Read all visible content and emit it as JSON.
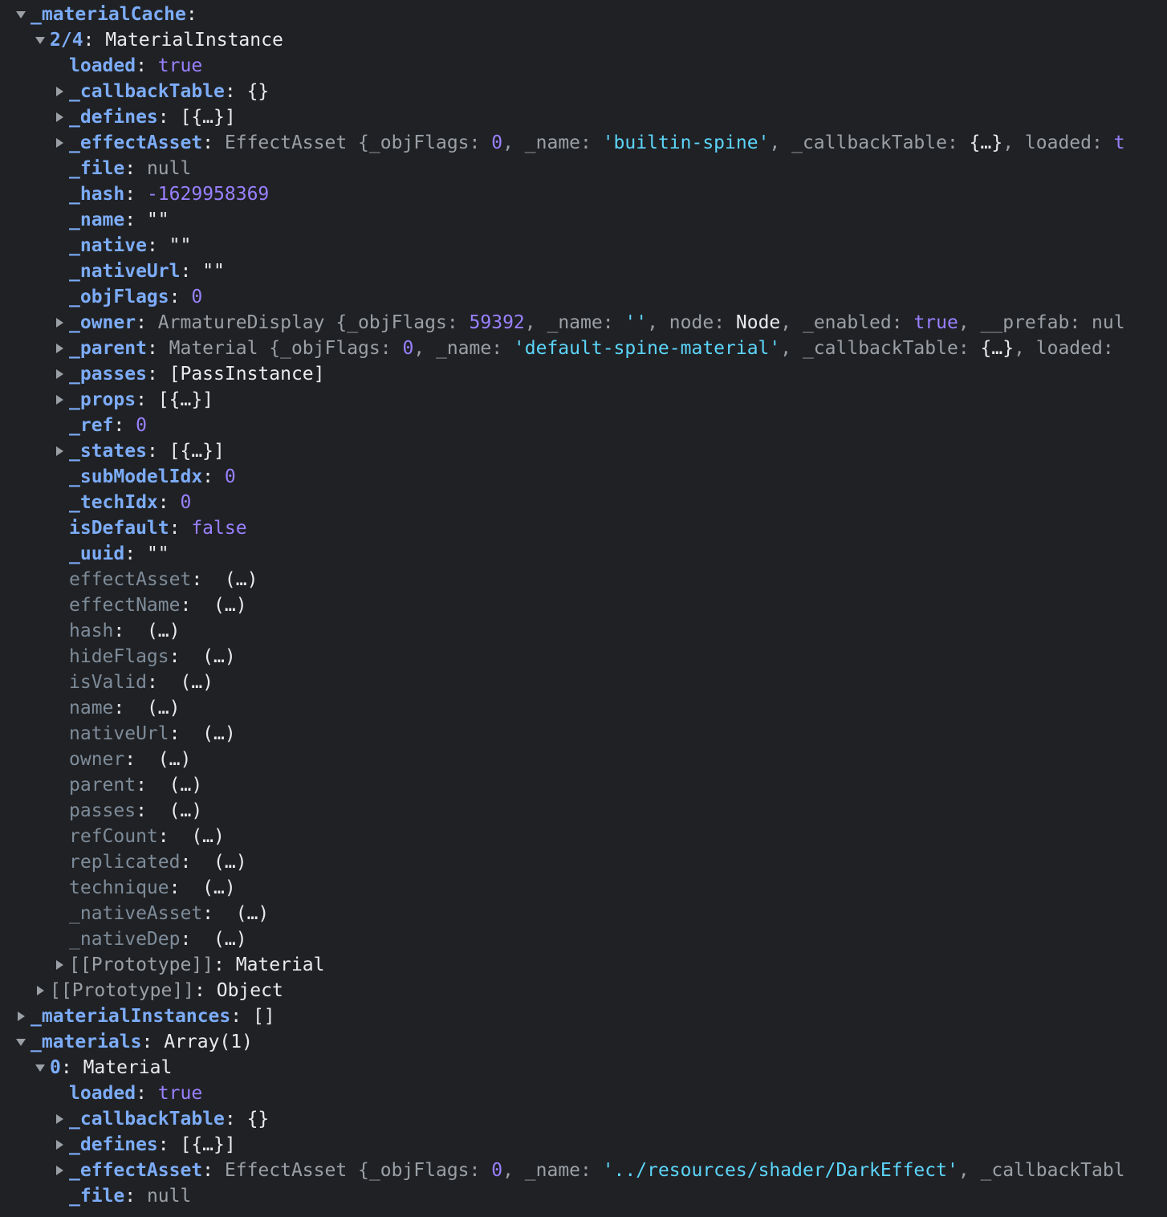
{
  "rows": [
    {
      "depth": 0,
      "state": "expanded",
      "key": "_materialCache",
      "kind": "own",
      "segs": []
    },
    {
      "depth": 1,
      "state": "expanded",
      "key": "2/4",
      "kind": "own",
      "segs": [
        {
          "t": "MaterialInstance",
          "c": "plain"
        }
      ]
    },
    {
      "depth": 2,
      "state": "none",
      "key": "loaded",
      "kind": "own",
      "segs": [
        {
          "t": "true",
          "c": "bool"
        }
      ]
    },
    {
      "depth": 2,
      "state": "collapsed",
      "key": "_callbackTable",
      "kind": "own",
      "segs": [
        {
          "t": "{}",
          "c": "plain"
        }
      ]
    },
    {
      "depth": 2,
      "state": "collapsed",
      "key": "_defines",
      "kind": "own",
      "segs": [
        {
          "t": "[{…}]",
          "c": "plain"
        }
      ]
    },
    {
      "depth": 2,
      "state": "collapsed",
      "key": "_effectAsset",
      "kind": "own",
      "segs": [
        {
          "t": "EffectAsset {_objFlags: ",
          "c": "gray"
        },
        {
          "t": "0",
          "c": "num"
        },
        {
          "t": ", _name: ",
          "c": "gray"
        },
        {
          "t": "'builtin-spine'",
          "c": "str"
        },
        {
          "t": ", _callbackTable: ",
          "c": "gray"
        },
        {
          "t": "{…}",
          "c": "plain"
        },
        {
          "t": ", loaded: ",
          "c": "gray"
        },
        {
          "t": "t",
          "c": "bool"
        }
      ]
    },
    {
      "depth": 2,
      "state": "none",
      "key": "_file",
      "kind": "own",
      "segs": [
        {
          "t": "null",
          "c": "null"
        }
      ]
    },
    {
      "depth": 2,
      "state": "none",
      "key": "_hash",
      "kind": "own",
      "segs": [
        {
          "t": "-1629958369",
          "c": "num"
        }
      ]
    },
    {
      "depth": 2,
      "state": "none",
      "key": "_name",
      "kind": "own",
      "segs": [
        {
          "t": "\"\"",
          "c": "plain"
        }
      ]
    },
    {
      "depth": 2,
      "state": "none",
      "key": "_native",
      "kind": "own",
      "segs": [
        {
          "t": "\"\"",
          "c": "plain"
        }
      ]
    },
    {
      "depth": 2,
      "state": "none",
      "key": "_nativeUrl",
      "kind": "own",
      "segs": [
        {
          "t": "\"\"",
          "c": "plain"
        }
      ]
    },
    {
      "depth": 2,
      "state": "none",
      "key": "_objFlags",
      "kind": "own",
      "segs": [
        {
          "t": "0",
          "c": "num"
        }
      ]
    },
    {
      "depth": 2,
      "state": "collapsed",
      "key": "_owner",
      "kind": "own",
      "segs": [
        {
          "t": "ArmatureDisplay {_objFlags: ",
          "c": "gray"
        },
        {
          "t": "59392",
          "c": "num"
        },
        {
          "t": ", _name: ",
          "c": "gray"
        },
        {
          "t": "''",
          "c": "str"
        },
        {
          "t": ", node: ",
          "c": "gray"
        },
        {
          "t": "Node",
          "c": "plain"
        },
        {
          "t": ", _enabled: ",
          "c": "gray"
        },
        {
          "t": "true",
          "c": "bool"
        },
        {
          "t": ", __prefab: ",
          "c": "gray"
        },
        {
          "t": "nul",
          "c": "null"
        }
      ]
    },
    {
      "depth": 2,
      "state": "collapsed",
      "key": "_parent",
      "kind": "own",
      "segs": [
        {
          "t": "Material {_objFlags: ",
          "c": "gray"
        },
        {
          "t": "0",
          "c": "num"
        },
        {
          "t": ", _name: ",
          "c": "gray"
        },
        {
          "t": "'default-spine-material'",
          "c": "str"
        },
        {
          "t": ", _callbackTable: ",
          "c": "gray"
        },
        {
          "t": "{…}",
          "c": "plain"
        },
        {
          "t": ", loaded: ",
          "c": "gray"
        }
      ]
    },
    {
      "depth": 2,
      "state": "collapsed",
      "key": "_passes",
      "kind": "own",
      "segs": [
        {
          "t": "[PassInstance]",
          "c": "plain"
        }
      ]
    },
    {
      "depth": 2,
      "state": "collapsed",
      "key": "_props",
      "kind": "own",
      "segs": [
        {
          "t": "[{…}]",
          "c": "plain"
        }
      ]
    },
    {
      "depth": 2,
      "state": "none",
      "key": "_ref",
      "kind": "own",
      "segs": [
        {
          "t": "0",
          "c": "num"
        }
      ]
    },
    {
      "depth": 2,
      "state": "collapsed",
      "key": "_states",
      "kind": "own",
      "segs": [
        {
          "t": "[{…}]",
          "c": "plain"
        }
      ]
    },
    {
      "depth": 2,
      "state": "none",
      "key": "_subModelIdx",
      "kind": "own",
      "segs": [
        {
          "t": "0",
          "c": "num"
        }
      ]
    },
    {
      "depth": 2,
      "state": "none",
      "key": "_techIdx",
      "kind": "own",
      "segs": [
        {
          "t": "0",
          "c": "num"
        }
      ]
    },
    {
      "depth": 2,
      "state": "none",
      "key": "isDefault",
      "kind": "own",
      "segs": [
        {
          "t": "false",
          "c": "bool"
        }
      ]
    },
    {
      "depth": 2,
      "state": "none",
      "key": "_uuid",
      "kind": "own",
      "segs": [
        {
          "t": "\"\"",
          "c": "plain"
        }
      ]
    },
    {
      "depth": 2,
      "state": "none",
      "key": "effectAsset",
      "kind": "acc",
      "segs": [
        {
          "t": " (…)",
          "c": "acc"
        }
      ]
    },
    {
      "depth": 2,
      "state": "none",
      "key": "effectName",
      "kind": "acc",
      "segs": [
        {
          "t": " (…)",
          "c": "acc"
        }
      ]
    },
    {
      "depth": 2,
      "state": "none",
      "key": "hash",
      "kind": "acc",
      "segs": [
        {
          "t": " (…)",
          "c": "acc"
        }
      ]
    },
    {
      "depth": 2,
      "state": "none",
      "key": "hideFlags",
      "kind": "acc",
      "segs": [
        {
          "t": " (…)",
          "c": "acc"
        }
      ]
    },
    {
      "depth": 2,
      "state": "none",
      "key": "isValid",
      "kind": "acc",
      "segs": [
        {
          "t": " (…)",
          "c": "acc"
        }
      ]
    },
    {
      "depth": 2,
      "state": "none",
      "key": "name",
      "kind": "acc",
      "segs": [
        {
          "t": " (…)",
          "c": "acc"
        }
      ]
    },
    {
      "depth": 2,
      "state": "none",
      "key": "nativeUrl",
      "kind": "acc",
      "segs": [
        {
          "t": " (…)",
          "c": "acc"
        }
      ]
    },
    {
      "depth": 2,
      "state": "none",
      "key": "owner",
      "kind": "acc",
      "segs": [
        {
          "t": " (…)",
          "c": "acc"
        }
      ]
    },
    {
      "depth": 2,
      "state": "none",
      "key": "parent",
      "kind": "acc",
      "segs": [
        {
          "t": " (…)",
          "c": "acc"
        }
      ]
    },
    {
      "depth": 2,
      "state": "none",
      "key": "passes",
      "kind": "acc",
      "segs": [
        {
          "t": " (…)",
          "c": "acc"
        }
      ]
    },
    {
      "depth": 2,
      "state": "none",
      "key": "refCount",
      "kind": "acc",
      "segs": [
        {
          "t": " (…)",
          "c": "acc"
        }
      ]
    },
    {
      "depth": 2,
      "state": "none",
      "key": "replicated",
      "kind": "acc",
      "segs": [
        {
          "t": " (…)",
          "c": "acc"
        }
      ]
    },
    {
      "depth": 2,
      "state": "none",
      "key": "technique",
      "kind": "acc",
      "segs": [
        {
          "t": " (…)",
          "c": "acc"
        }
      ]
    },
    {
      "depth": 2,
      "state": "none",
      "key": "_nativeAsset",
      "kind": "acc",
      "segs": [
        {
          "t": " (…)",
          "c": "acc"
        }
      ]
    },
    {
      "depth": 2,
      "state": "none",
      "key": "_nativeDep",
      "kind": "acc",
      "segs": [
        {
          "t": " (…)",
          "c": "acc"
        }
      ]
    },
    {
      "depth": 2,
      "state": "collapsed",
      "key": "[[Prototype]]",
      "kind": "proto",
      "segs": [
        {
          "t": "Material",
          "c": "plain"
        }
      ]
    },
    {
      "depth": 1,
      "state": "collapsed",
      "key": "[[Prototype]]",
      "kind": "proto",
      "segs": [
        {
          "t": "Object",
          "c": "plain"
        }
      ]
    },
    {
      "depth": 0,
      "state": "collapsed",
      "key": "_materialInstances",
      "kind": "own",
      "segs": [
        {
          "t": "[]",
          "c": "plain"
        }
      ]
    },
    {
      "depth": 0,
      "state": "expanded",
      "key": "_materials",
      "kind": "own",
      "segs": [
        {
          "t": "Array(1)",
          "c": "plain"
        }
      ]
    },
    {
      "depth": 1,
      "state": "expanded",
      "key": "0",
      "kind": "own",
      "segs": [
        {
          "t": "Material",
          "c": "plain"
        }
      ]
    },
    {
      "depth": 2,
      "state": "none",
      "key": "loaded",
      "kind": "own",
      "segs": [
        {
          "t": "true",
          "c": "bool"
        }
      ]
    },
    {
      "depth": 2,
      "state": "collapsed",
      "key": "_callbackTable",
      "kind": "own",
      "segs": [
        {
          "t": "{}",
          "c": "plain"
        }
      ]
    },
    {
      "depth": 2,
      "state": "collapsed",
      "key": "_defines",
      "kind": "own",
      "segs": [
        {
          "t": "[{…}]",
          "c": "plain"
        }
      ]
    },
    {
      "depth": 2,
      "state": "collapsed",
      "key": "_effectAsset",
      "kind": "own",
      "segs": [
        {
          "t": "EffectAsset {_objFlags: ",
          "c": "gray"
        },
        {
          "t": "0",
          "c": "num"
        },
        {
          "t": ", _name: ",
          "c": "gray"
        },
        {
          "t": "'../resources/shader/DarkEffect'",
          "c": "str"
        },
        {
          "t": ", _callbackTabl",
          "c": "gray"
        }
      ]
    },
    {
      "depth": 2,
      "state": "none",
      "key": "_file",
      "kind": "own",
      "segs": [
        {
          "t": "null",
          "c": "null"
        }
      ]
    }
  ]
}
